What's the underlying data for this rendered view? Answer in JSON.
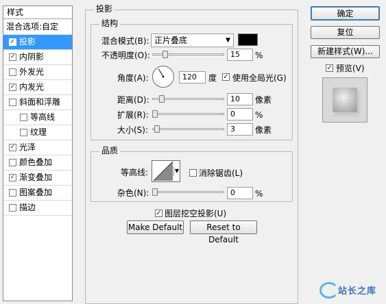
{
  "style_panel": {
    "header": "样式",
    "items": [
      {
        "label": "混合选项:自定",
        "has_checkbox": false,
        "checked": false,
        "selected": false,
        "indent": false
      },
      {
        "label": "投影",
        "has_checkbox": true,
        "checked": true,
        "selected": true,
        "indent": false
      },
      {
        "label": "内阴影",
        "has_checkbox": true,
        "checked": true,
        "selected": false,
        "indent": false
      },
      {
        "label": "外发光",
        "has_checkbox": true,
        "checked": false,
        "selected": false,
        "indent": false
      },
      {
        "label": "内发光",
        "has_checkbox": true,
        "checked": true,
        "selected": false,
        "indent": false
      },
      {
        "label": "斜面和浮雕",
        "has_checkbox": true,
        "checked": false,
        "selected": false,
        "indent": false
      },
      {
        "label": "等高线",
        "has_checkbox": true,
        "checked": false,
        "selected": false,
        "indent": true
      },
      {
        "label": "纹理",
        "has_checkbox": true,
        "checked": false,
        "selected": false,
        "indent": true
      },
      {
        "label": "光泽",
        "has_checkbox": true,
        "checked": true,
        "selected": false,
        "indent": false
      },
      {
        "label": "颜色叠加",
        "has_checkbox": true,
        "checked": false,
        "selected": false,
        "indent": false
      },
      {
        "label": "渐变叠加",
        "has_checkbox": true,
        "checked": true,
        "selected": false,
        "indent": false
      },
      {
        "label": "图案叠加",
        "has_checkbox": true,
        "checked": false,
        "selected": false,
        "indent": false
      },
      {
        "label": "描边",
        "has_checkbox": true,
        "checked": false,
        "selected": false,
        "indent": false
      }
    ]
  },
  "drop_shadow": {
    "title": "投影",
    "structure": {
      "title": "结构",
      "blend_mode_label": "混合模式(B):",
      "blend_mode_value": "正片叠底",
      "shadow_color": "#000000",
      "opacity_label": "不透明度(O):",
      "opacity_value": "15",
      "opacity_unit": "%",
      "opacity_pct": 15,
      "angle_label": "角度(A):",
      "angle_value": "120",
      "angle_unit": "度",
      "angle_degrees": 120,
      "global_light_label": "使用全局光(G)",
      "global_light_checked": true,
      "distance_label": "距离(D):",
      "distance_value": "10",
      "distance_unit": "像素",
      "distance_level": 10,
      "spread_label": "扩展(R):",
      "spread_value": "0",
      "spread_unit": "%",
      "spread_level": 0,
      "size_label": "大小(S):",
      "size_value": "3",
      "size_unit": "像素",
      "size_level": 3
    },
    "quality": {
      "title": "品质",
      "contour_label": "等高线:",
      "anti_alias_label": "消除锯齿(L)",
      "anti_alias_checked": false,
      "noise_label": "杂色(N):",
      "noise_value": "0",
      "noise_unit": "%",
      "noise_level": 0
    },
    "knockout_label": "图层挖空投影(U)",
    "knockout_checked": true,
    "make_default_label": "Make Default",
    "reset_default_label": "Reset to Default"
  },
  "right_panel": {
    "ok_label": "确定",
    "reset_label": "复位",
    "new_style_label": "新建样式(W)...",
    "preview_label": "预览(V)",
    "preview_checked": true
  },
  "watermark": "站长之库"
}
